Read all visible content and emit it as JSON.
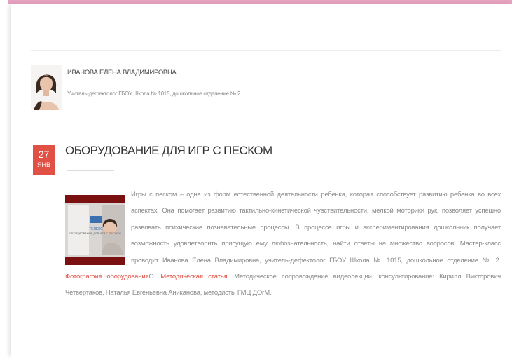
{
  "colors": {
    "accent": "#e05044",
    "top_bar": "#e6a3bf",
    "text": "#333333",
    "muted_text": "#8a8a8a"
  },
  "author": {
    "name": "ИВАНОВА ЕЛЕНА ВЛАДИМИРОВНА",
    "role": "Учитель-дефектолог ГБОУ Школа № 1015, дошкольное отделение № 2"
  },
  "post": {
    "date": {
      "day": "27",
      "month": "ЯНВ"
    },
    "title": "ОБОРУДОВАНИЕ ДЛЯ ИГР С ПЕСКОМ",
    "thumbnail": {
      "caption": "ОБОРУДОВАНИЕ ДЛЯ ИГР С ПЕСКОМ",
      "logo": "ТЕЛЕКС"
    },
    "body_text": "Игры с песком – одна из форм естественной деятельности ребенка, которая способствует развитию ребенка во всех аспектах. Она помогает развитию тактильно-кинетической чувствительности, мелкой моторики рук, позволяет успешно развивать психические познавательные процессы. В процессе игры и экспериментирования дошкольник получает возможность удовлетворить присущую ему любознательность, найти ответы на множество вопросов. Мастер-класс проводит Иванова Елена Владимировна, учитель-дефектолог ГБОУ Школа № 1015, дошкольное отделение № 2.",
    "link_photo": "Фотография оборудования",
    "separator": "О.",
    "link_article": "Методическая статья",
    "tail_text": ". Методическое сопровождение видеолекции, консультирование: Кирилл Викторович Четвертаков, Наталья Евгеньевна Аниканова, методисты ГМЦ ДОгМ."
  }
}
